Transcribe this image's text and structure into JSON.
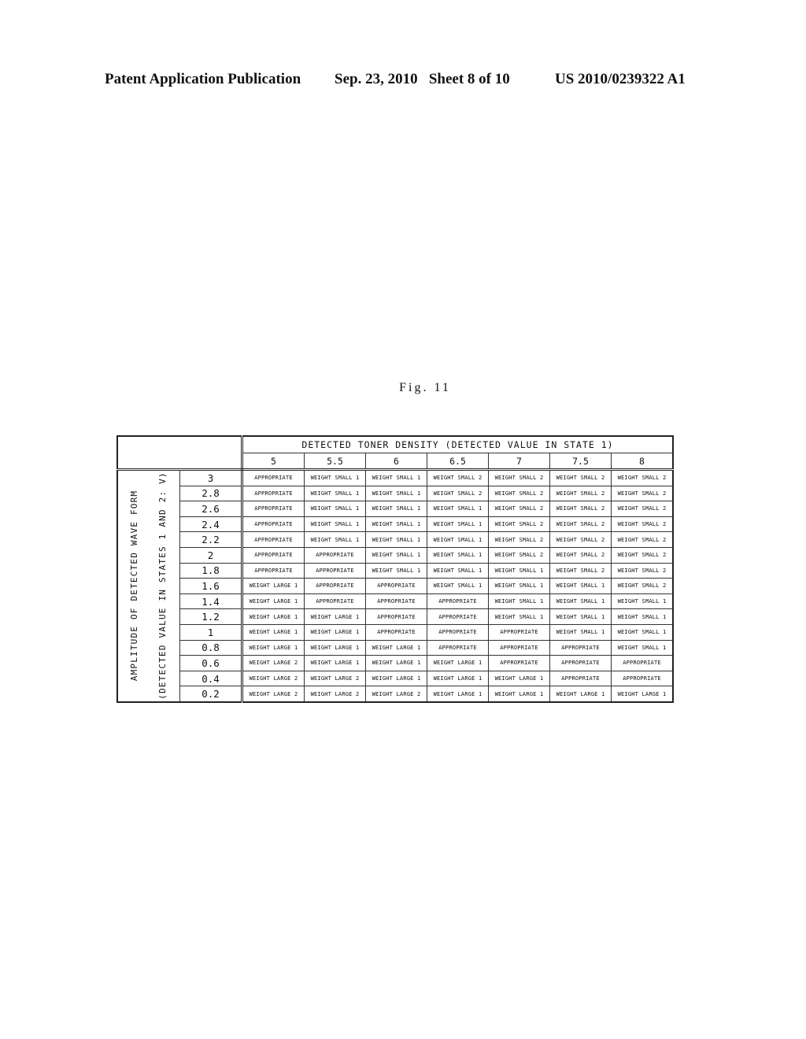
{
  "header": {
    "left": "Patent Application Publication",
    "middle": "Sep. 23, 2010   Sheet 8 of 10",
    "right": "US 2010/0239322 A1"
  },
  "figure_label": "Fig. 11",
  "table": {
    "column_title": "DETECTED TONER DENSITY (DETECTED VALUE IN STATE 1)",
    "row_title_line1": "AMPLITUDE OF DETECTED WAVE FORM",
    "row_title_line2": "(DETECTED VALUE IN STATES 1 AND 2: V)",
    "columns": [
      "5",
      "5.5",
      "6",
      "6.5",
      "7",
      "7.5",
      "8"
    ],
    "rows": [
      {
        "amp": "3",
        "cells": [
          "APPROPRIATE",
          "WEIGHT SMALL 1",
          "WEIGHT SMALL 1",
          "WEIGHT SMALL 2",
          "WEIGHT SMALL 2",
          "WEIGHT SMALL 2",
          "WEIGHT SMALL 2"
        ]
      },
      {
        "amp": "2.8",
        "cells": [
          "APPROPRIATE",
          "WEIGHT SMALL 1",
          "WEIGHT SMALL 1",
          "WEIGHT SMALL 2",
          "WEIGHT SMALL 2",
          "WEIGHT SMALL 2",
          "WEIGHT SMALL 2"
        ]
      },
      {
        "amp": "2.6",
        "cells": [
          "APPROPRIATE",
          "WEIGHT SMALL 1",
          "WEIGHT SMALL 1",
          "WEIGHT SMALL 1",
          "WEIGHT SMALL 2",
          "WEIGHT SMALL 2",
          "WEIGHT SMALL 2"
        ]
      },
      {
        "amp": "2.4",
        "cells": [
          "APPROPRIATE",
          "WEIGHT SMALL 1",
          "WEIGHT SMALL 1",
          "WEIGHT SMALL 1",
          "WEIGHT SMALL 2",
          "WEIGHT SMALL 2",
          "WEIGHT SMALL 2"
        ]
      },
      {
        "amp": "2.2",
        "cells": [
          "APPROPRIATE",
          "WEIGHT SMALL 1",
          "WEIGHT SMALL 1",
          "WEIGHT SMALL 1",
          "WEIGHT SMALL 2",
          "WEIGHT SMALL 2",
          "WEIGHT SMALL 2"
        ]
      },
      {
        "amp": "2",
        "cells": [
          "APPROPRIATE",
          "APPROPRIATE",
          "WEIGHT SMALL 1",
          "WEIGHT SMALL 1",
          "WEIGHT SMALL 2",
          "WEIGHT SMALL 2",
          "WEIGHT SMALL 2"
        ]
      },
      {
        "amp": "1.8",
        "cells": [
          "APPROPRIATE",
          "APPROPRIATE",
          "WEIGHT SMALL 1",
          "WEIGHT SMALL 1",
          "WEIGHT SMALL 1",
          "WEIGHT SMALL 2",
          "WEIGHT SMALL 2"
        ]
      },
      {
        "amp": "1.6",
        "cells": [
          "WEIGHT LARGE 1",
          "APPROPRIATE",
          "APPROPRIATE",
          "WEIGHT SMALL 1",
          "WEIGHT SMALL 1",
          "WEIGHT SMALL 1",
          "WEIGHT SMALL 2"
        ]
      },
      {
        "amp": "1.4",
        "cells": [
          "WEIGHT LARGE 1",
          "APPROPRIATE",
          "APPROPRIATE",
          "APPROPRIATE",
          "WEIGHT SMALL 1",
          "WEIGHT SMALL 1",
          "WEIGHT SMALL 1"
        ]
      },
      {
        "amp": "1.2",
        "cells": [
          "WEIGHT LARGE 1",
          "WEIGHT LARGE 1",
          "APPROPRIATE",
          "APPROPRIATE",
          "WEIGHT SMALL 1",
          "WEIGHT SMALL 1",
          "WEIGHT SMALL 1"
        ]
      },
      {
        "amp": "1",
        "cells": [
          "WEIGHT LARGE 1",
          "WEIGHT LARGE 1",
          "APPROPRIATE",
          "APPROPRIATE",
          "APPROPRIATE",
          "WEIGHT SMALL 1",
          "WEIGHT SMALL 1"
        ]
      },
      {
        "amp": "0.8",
        "cells": [
          "WEIGHT LARGE 1",
          "WEIGHT LARGE 1",
          "WEIGHT LARGE 1",
          "APPROPRIATE",
          "APPROPRIATE",
          "APPROPRIATE",
          "WEIGHT SMALL 1"
        ]
      },
      {
        "amp": "0.6",
        "cells": [
          "WEIGHT LARGE 2",
          "WEIGHT LARGE 1",
          "WEIGHT LARGE 1",
          "WEIGHT LARGE 1",
          "APPROPRIATE",
          "APPROPRIATE",
          "APPROPRIATE"
        ]
      },
      {
        "amp": "0.4",
        "cells": [
          "WEIGHT LARGE 2",
          "WEIGHT LARGE 2",
          "WEIGHT LARGE 1",
          "WEIGHT LARGE 1",
          "WEIGHT LARGE 1",
          "APPROPRIATE",
          "APPROPRIATE"
        ]
      },
      {
        "amp": "0.2",
        "cells": [
          "WEIGHT LARGE 2",
          "WEIGHT LARGE 2",
          "WEIGHT LARGE 2",
          "WEIGHT LARGE 1",
          "WEIGHT LARGE 1",
          "WEIGHT LARGE 1",
          "WEIGHT LARGE 1"
        ]
      }
    ]
  }
}
